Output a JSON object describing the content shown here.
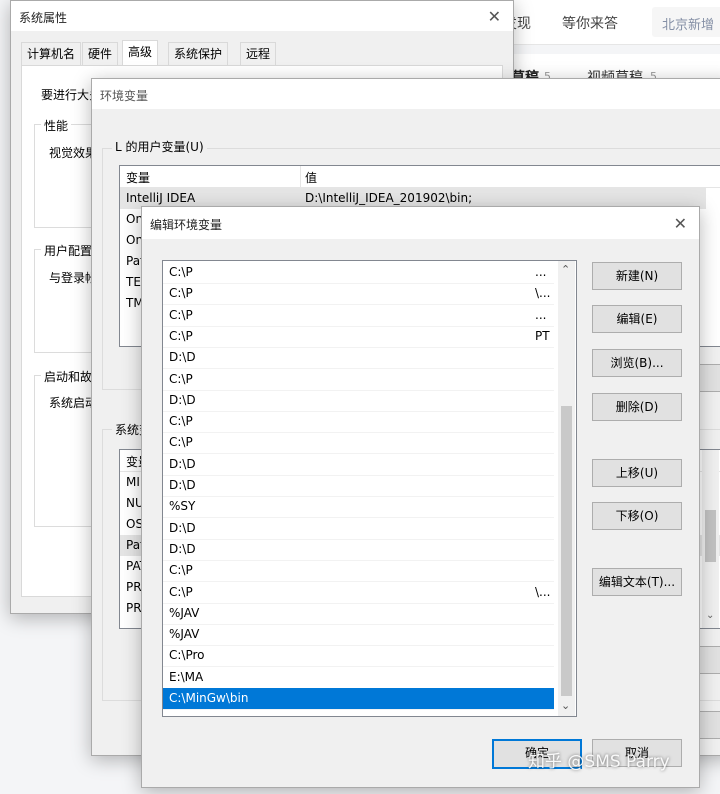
{
  "zhihu": {
    "nav_discover": "发现",
    "nav_waiting": "等你来答",
    "nav_beijing": "北京新增",
    "drafts_article": "草稿",
    "drafts_article_count": "5",
    "drafts_video": "视频草稿",
    "drafts_video_count": "5"
  },
  "sysprops": {
    "title": "系统属性",
    "tabs": [
      "计算机名",
      "硬件",
      "高级",
      "系统保护",
      "远程"
    ],
    "admin_note": "要进行大多",
    "perf_label": "性能",
    "perf_text": "视觉效果",
    "profile_label": "用户配置",
    "profile_text": "与登录帐",
    "startup_label": "启动和故",
    "startup_text": "系统启动"
  },
  "envvars": {
    "title": "环境变量",
    "user_vars_label": "L 的用户变量(U)",
    "col_var": "变量",
    "col_val": "值",
    "user_rows": [
      {
        "name": "IntelliJ IDEA",
        "value": "D:\\IntelliJ_IDEA_201902\\bin;"
      },
      {
        "name": "On",
        "value": ""
      },
      {
        "name": "On",
        "value": ""
      },
      {
        "name": "Pat",
        "value": ""
      },
      {
        "name": "TEN",
        "value": ""
      },
      {
        "name": "TM",
        "value": ""
      }
    ],
    "sys_vars_label": "系统变",
    "sys_col_var": "变量",
    "sys_rows": [
      "MI",
      "NU",
      "OS",
      "Pat",
      "PAT",
      "PRO",
      "PRO"
    ]
  },
  "edit": {
    "title": "编辑环境变量",
    "entries": [
      "C:\\P",
      "C:\\P",
      "C:\\P",
      "C:\\P",
      "D:\\D",
      "C:\\P",
      "D:\\D",
      "C:\\P",
      "C:\\P",
      "D:\\D",
      "D:\\D",
      "%SY",
      "D:\\D",
      "D:\\D",
      "C:\\P",
      "C:\\P",
      "%JAV",
      "%JAV",
      "C:\\Pro",
      "E:\\MA",
      "C:\\MinGw\\bin"
    ],
    "tails": [
      "...",
      "\\...",
      "...",
      "PT",
      "",
      "",
      "",
      "",
      "",
      "",
      "",
      "",
      "",
      "",
      "",
      "\\..."
    ],
    "selected_index": 20,
    "buttons": {
      "new": "新建(N)",
      "edit": "编辑(E)",
      "browse": "浏览(B)...",
      "delete": "删除(D)",
      "up": "上移(U)",
      "down": "下移(O)",
      "edit_text": "编辑文本(T)...",
      "ok": "确定",
      "cancel": "取消"
    }
  },
  "watermark": "知乎 @SMS Parry"
}
